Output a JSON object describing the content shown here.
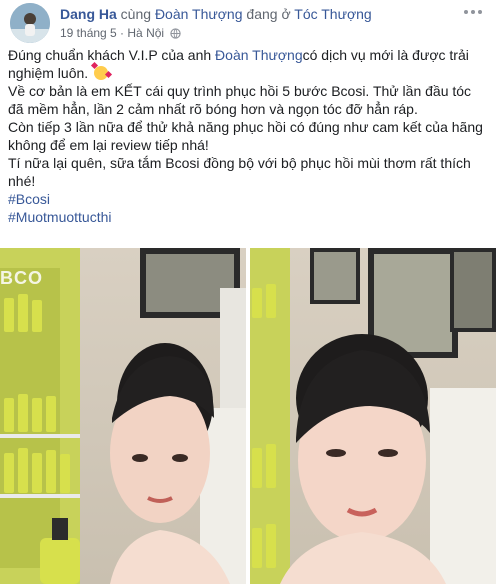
{
  "post": {
    "author": "Dang Ha",
    "with_text": " cùng ",
    "tagged_page": "Đoàn Thượng",
    "at_text": " đang ở ",
    "location": "Tóc Thượng",
    "date": "19 tháng 5",
    "dot": " · ",
    "place": "Hà Nội",
    "privacy_icon": "globe-icon",
    "body": {
      "line1_prefix": "Đúng chuẩn khách V.I.P của anh ",
      "line1_mention": "Đoàn Thượng",
      "line1_suffix": "có dịch vụ mới là được trải nghiệm luôn.",
      "emoji_name": "smiling-face-with-hearts",
      "para2": "Về cơ bản là em KẾT cái quy trình phục hồi 5 bước Bcosi. Thử lần đầu tóc đã mềm hẳn, lần 2 cảm nhất rõ bóng hơn và ngọn tóc đỡ hẳn ráp.",
      "para3": "Còn tiếp 3 lần nữa để thử khả năng phục hồi có đúng như cam kết của hãng không để em lại review tiếp nhá!",
      "para4": "Tí nữa lại quên, sữa tắm Bcosi đồng bộ với bộ phục hồi mùi thơm rất thích nhé!",
      "hashtags": [
        "#Bcosi",
        "#Muotmuottucthi"
      ]
    },
    "photos": {
      "brand_text": "BCO"
    }
  }
}
